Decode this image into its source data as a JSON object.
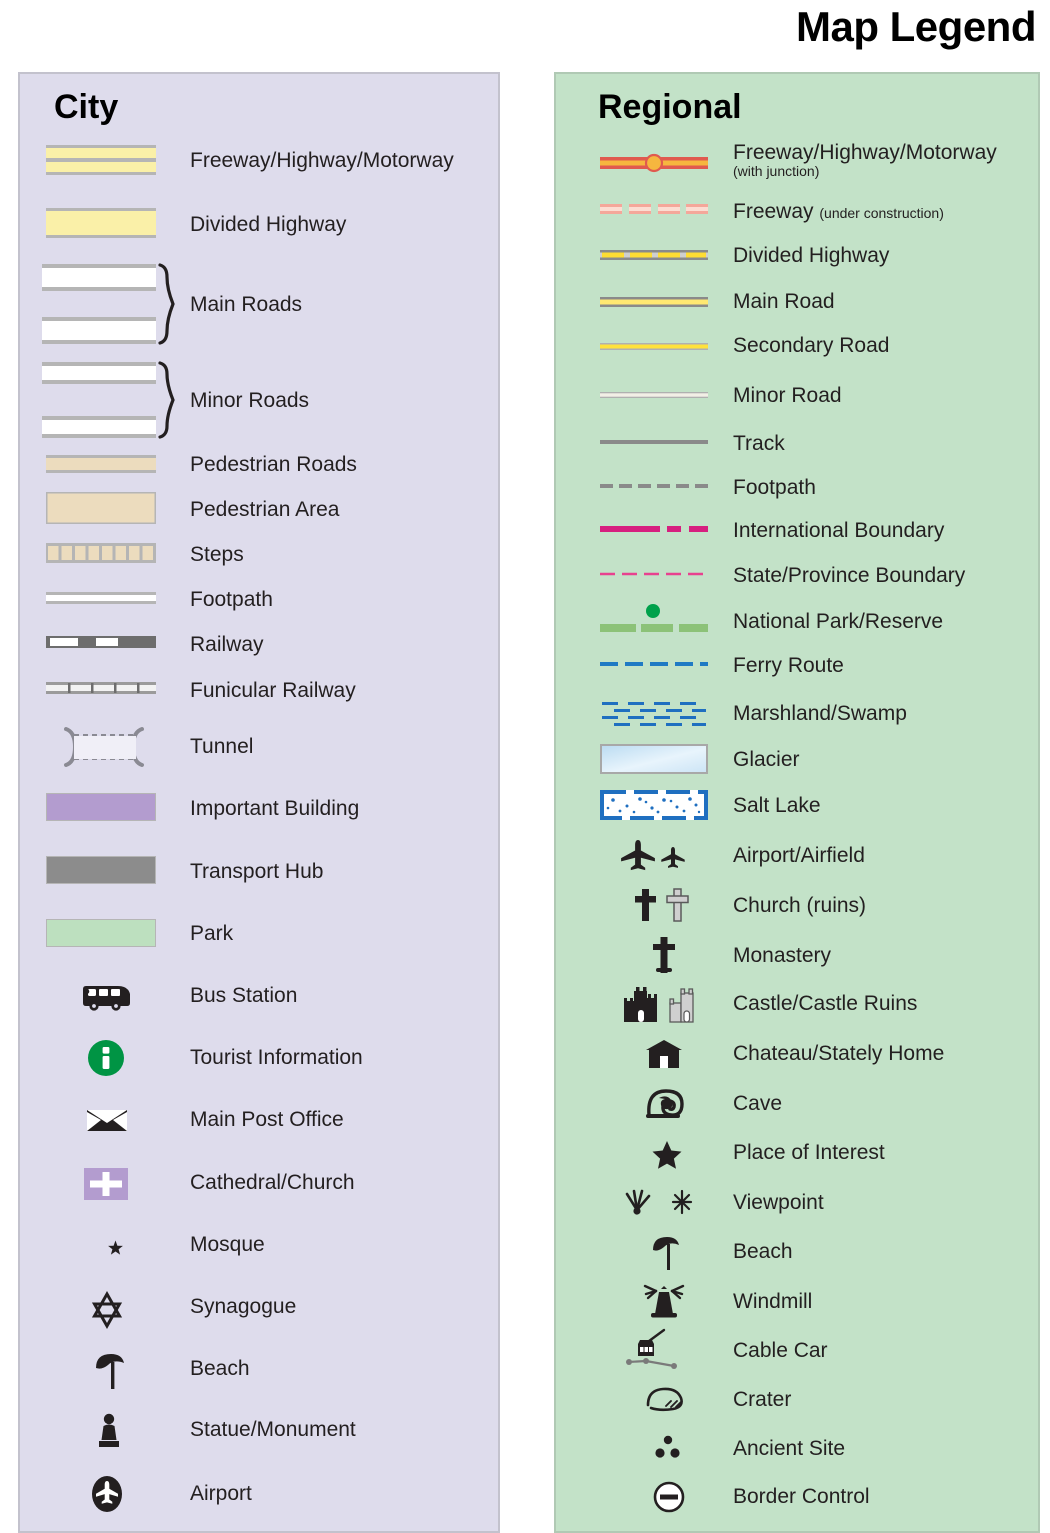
{
  "title": "Map Legend",
  "city": {
    "heading": "City",
    "items": [
      {
        "label": "Freeway/Highway/Motorway",
        "icon": "freeway-bar-double"
      },
      {
        "label": "Divided Highway",
        "icon": "divided-highway-bar"
      },
      {
        "label": "Main Roads",
        "icon": "main-roads-brace"
      },
      {
        "label": "Minor Roads",
        "icon": "minor-roads-brace"
      },
      {
        "label": "Pedestrian Roads",
        "icon": "pedestrian-road-bar"
      },
      {
        "label": "Pedestrian Area",
        "icon": "pedestrian-area-bar"
      },
      {
        "label": "Steps",
        "icon": "steps-bar"
      },
      {
        "label": "Footpath",
        "icon": "footpath-line"
      },
      {
        "label": "Railway",
        "icon": "railway-line"
      },
      {
        "label": "Funicular Railway",
        "icon": "funicular-railway-line"
      },
      {
        "label": "Tunnel",
        "icon": "tunnel-symbol"
      },
      {
        "label": "Important Building",
        "icon": "important-building-swatch"
      },
      {
        "label": "Transport Hub",
        "icon": "transport-hub-swatch"
      },
      {
        "label": "Park",
        "icon": "park-swatch"
      },
      {
        "label": "Bus Station",
        "icon": "bus-icon"
      },
      {
        "label": "Tourist Information",
        "icon": "information-icon"
      },
      {
        "label": "Main Post Office",
        "icon": "envelope-icon"
      },
      {
        "label": "Cathedral/Church",
        "icon": "church-cross-icon"
      },
      {
        "label": "Mosque",
        "icon": "crescent-star-icon"
      },
      {
        "label": "Synagogue",
        "icon": "star-of-david-icon"
      },
      {
        "label": "Beach",
        "icon": "beach-umbrella-icon"
      },
      {
        "label": "Statue/Monument",
        "icon": "statue-icon"
      },
      {
        "label": "Airport",
        "icon": "airport-icon"
      }
    ]
  },
  "regional": {
    "heading": "Regional",
    "items": [
      {
        "label": "Freeway/Highway/Motorway",
        "sublabel": "(with junction)",
        "icon": "freeway-junction-line"
      },
      {
        "label": "Freeway",
        "sublabel": "(under construction)",
        "icon": "freeway-construction-line"
      },
      {
        "label": "Divided Highway",
        "icon": "divided-highway-line"
      },
      {
        "label": "Main Road",
        "icon": "main-road-line"
      },
      {
        "label": "Secondary Road",
        "icon": "secondary-road-line"
      },
      {
        "label": "Minor Road",
        "icon": "minor-road-line"
      },
      {
        "label": "Track",
        "icon": "track-line"
      },
      {
        "label": "Footpath",
        "icon": "footpath-dashed-line"
      },
      {
        "label": "International Boundary",
        "icon": "international-boundary-line"
      },
      {
        "label": "State/Province Boundary",
        "icon": "state-boundary-line"
      },
      {
        "label": "National Park/Reserve",
        "icon": "national-park-line"
      },
      {
        "label": "Ferry Route",
        "icon": "ferry-route-line"
      },
      {
        "label": "Marshland/Swamp",
        "icon": "marshland-pattern"
      },
      {
        "label": "Glacier",
        "icon": "glacier-swatch"
      },
      {
        "label": "Salt Lake",
        "icon": "salt-lake-pattern"
      },
      {
        "label": "Airport/Airfield",
        "icon": "airplane-icon"
      },
      {
        "label": "Church (ruins)",
        "icon": "cross-icon"
      },
      {
        "label": "Monastery",
        "icon": "monastery-cross-icon"
      },
      {
        "label": "Castle/Castle Ruins",
        "icon": "castle-icon"
      },
      {
        "label": "Chateau/Stately Home",
        "icon": "chateau-icon"
      },
      {
        "label": "Cave",
        "icon": "cave-icon"
      },
      {
        "label": "Place of Interest",
        "icon": "star-icon"
      },
      {
        "label": "Viewpoint",
        "icon": "viewpoint-icon"
      },
      {
        "label": "Beach",
        "icon": "beach-umbrella-icon"
      },
      {
        "label": "Windmill",
        "icon": "windmill-icon"
      },
      {
        "label": "Cable Car",
        "icon": "cable-car-icon"
      },
      {
        "label": "Crater",
        "icon": "crater-icon"
      },
      {
        "label": "Ancient Site",
        "icon": "ancient-site-icon"
      },
      {
        "label": "Border Control",
        "icon": "border-control-icon"
      }
    ]
  },
  "colors": {
    "city_panel_bg": "#dedcec",
    "regional_panel_bg": "#c3e2c8",
    "highway_yellow": "#faf0a8",
    "road_white": "#ffffff",
    "road_casing_gray": "#b5b5b5",
    "pedestrian_tan": "#ecdcbe",
    "important_building_purple": "#b39ccf",
    "transport_hub_gray": "#8c8c8c",
    "park_green": "#bde0bf",
    "tourist_info_green": "#009444",
    "freeway_red": "#e05a4f",
    "freeway_orange": "#f6b63f",
    "freeway_construction_pink": "#f4a79a",
    "divided_highway_yellow": "#ffdd33",
    "track_gray": "#8a8a8a",
    "international_boundary_magenta": "#d6207f",
    "state_boundary_pink": "#e8418f",
    "national_park_green": "#8cc278",
    "national_park_dot": "#00a14b",
    "ferry_blue": "#1f7ac4",
    "marshland_blue": "#1f6fc0",
    "glacier_blue": "#cfe6f7",
    "salt_lake_blue": "#1f6fc0",
    "text_black": "#231f20"
  }
}
